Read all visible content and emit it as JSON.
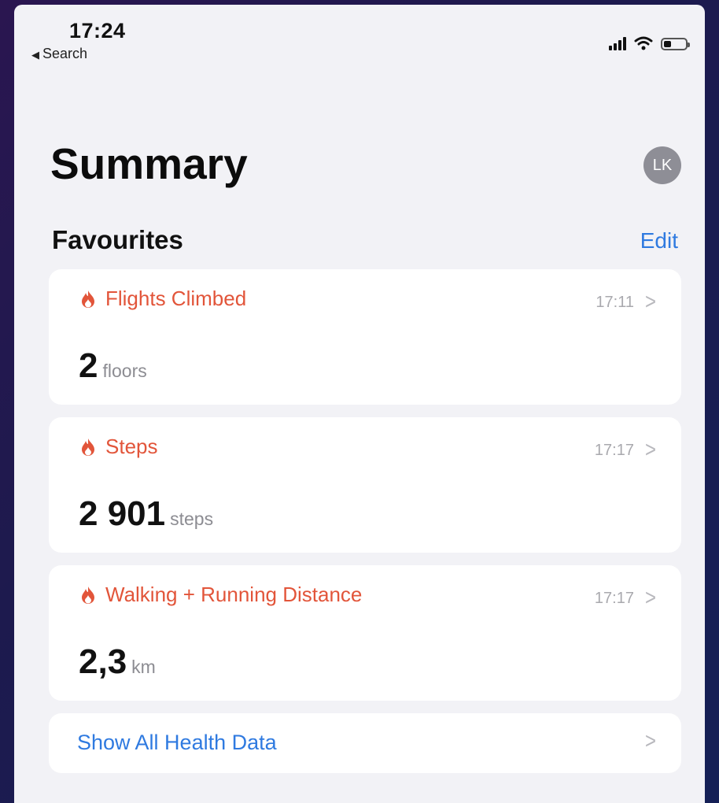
{
  "status_bar": {
    "time": "17:24",
    "back_label": "Search"
  },
  "header": {
    "title": "Summary",
    "avatar_initials": "LK"
  },
  "favourites": {
    "section_title": "Favourites",
    "edit_label": "Edit",
    "cards": [
      {
        "title": "Flights Climbed",
        "time": "17:11",
        "value": "2",
        "unit": "floors",
        "icon": "flame-icon"
      },
      {
        "title": "Steps",
        "time": "17:17",
        "value": "2 901",
        "unit": "steps",
        "icon": "flame-icon"
      },
      {
        "title": "Walking + Running Distance",
        "time": "17:17",
        "value": "2,3",
        "unit": "km",
        "icon": "flame-icon"
      }
    ]
  },
  "show_all": {
    "label": "Show All Health Data"
  },
  "colors": {
    "accent_orange": "#e2553a",
    "link_blue": "#2f7ae0",
    "background": "#f2f2f6"
  }
}
